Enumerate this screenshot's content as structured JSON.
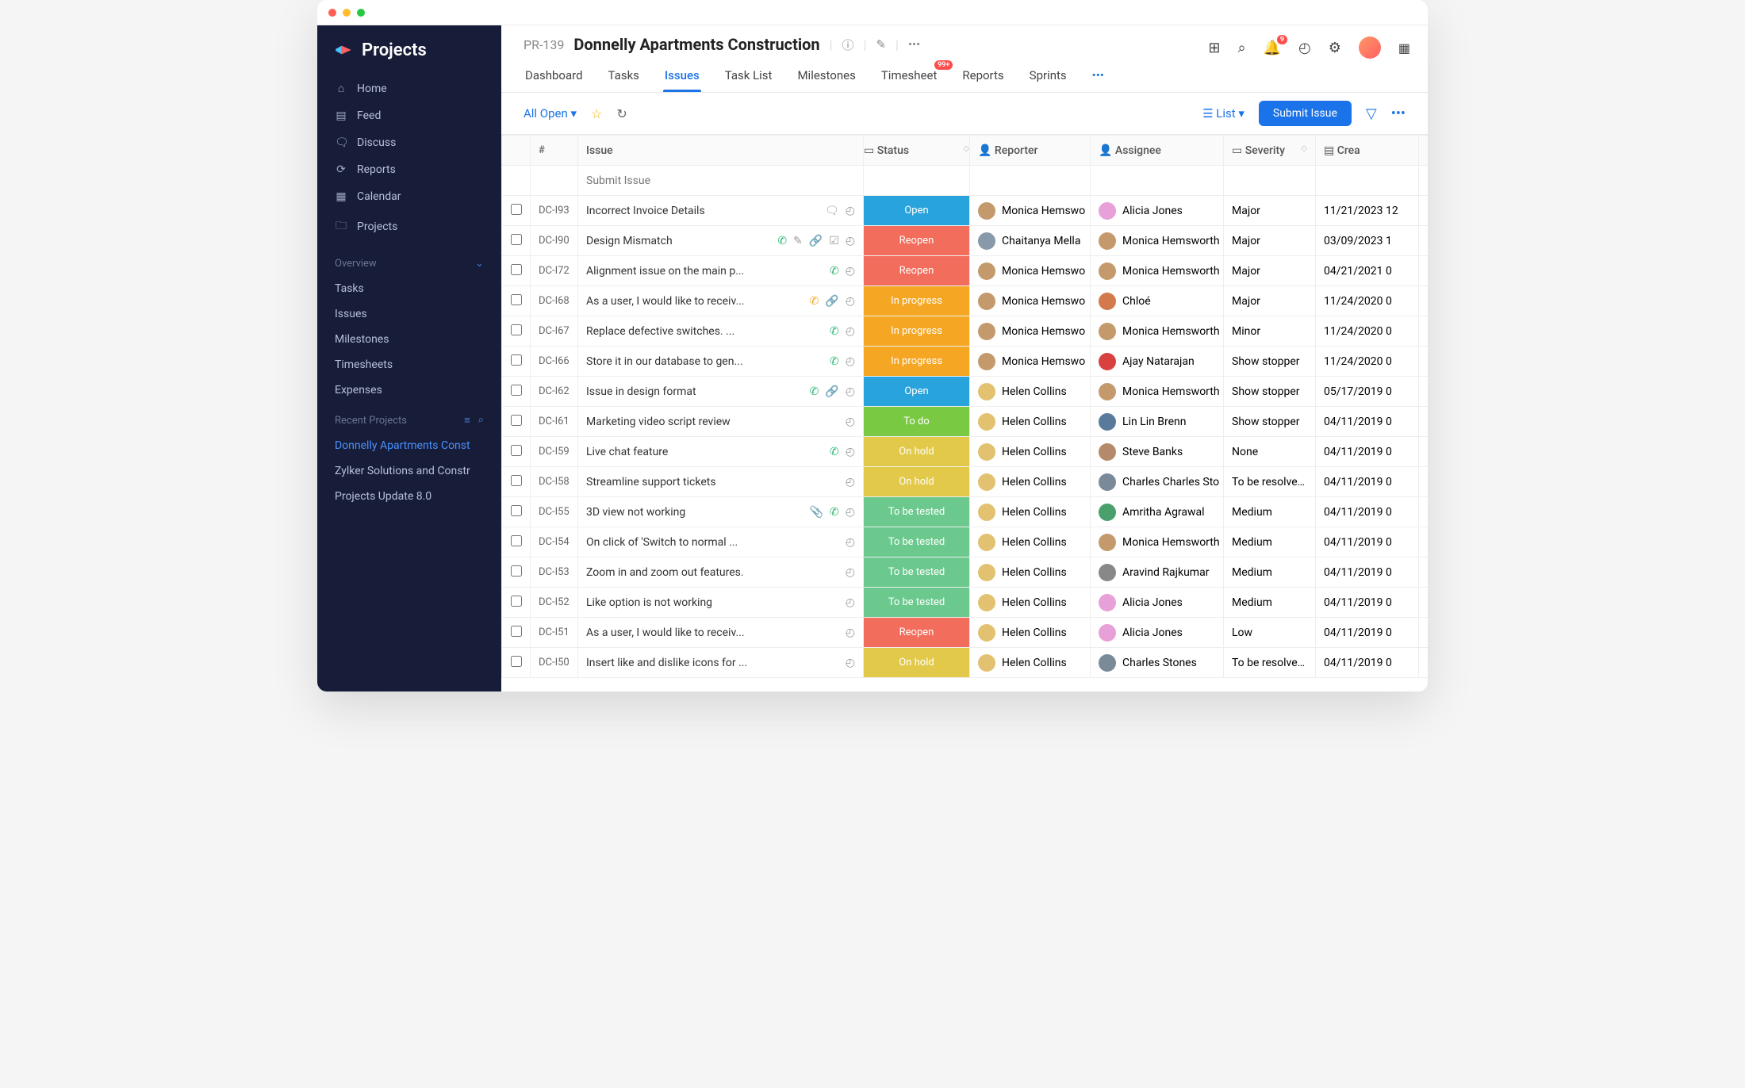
{
  "brand": "Projects",
  "nav": [
    {
      "icon": "⌂",
      "label": "Home"
    },
    {
      "icon": "▤",
      "label": "Feed"
    },
    {
      "icon": "🗨",
      "label": "Discuss"
    },
    {
      "icon": "⟳",
      "label": "Reports"
    },
    {
      "icon": "▦",
      "label": "Calendar"
    },
    {
      "icon": "🗀",
      "label": "Projects"
    }
  ],
  "overview_label": "Overview",
  "subnav": [
    "Tasks",
    "Issues",
    "Milestones",
    "Timesheets",
    "Expenses"
  ],
  "recent_label": "Recent Projects",
  "recent": [
    "Donnelly Apartments Const",
    "Zylker Solutions and Constr",
    "Projects Update 8.0"
  ],
  "header": {
    "project_key": "PR-139",
    "project_name": "Donnelly Apartments Construction",
    "notif_badge": "9",
    "timesheet_badge": "99+"
  },
  "tabs": [
    "Dashboard",
    "Tasks",
    "Issues",
    "Task List",
    "Milestones",
    "Timesheet",
    "Reports",
    "Sprints"
  ],
  "active_tab": "Issues",
  "toolbar": {
    "view_filter": "All Open",
    "list_label": "List",
    "submit_label": "Submit Issue",
    "submit_placeholder": "Submit Issue"
  },
  "columns": {
    "num": "#",
    "issue": "Issue",
    "status": "Status",
    "reporter": "Reporter",
    "assignee": "Assignee",
    "severity": "Severity",
    "created": "Crea"
  },
  "status_colors": {
    "Open": "st-open",
    "Reopen": "st-reopen",
    "In progress": "st-progress",
    "On hold": "st-hold",
    "To do": "st-todo",
    "To be tested": "st-test"
  },
  "avatar_colors": {
    "Monica Hemswo": "#c49a6c",
    "Monica Hemsworth": "#c49a6c",
    "Chaitanya Mella": "#8899aa",
    "Alicia Jones": "#e8a0d8",
    "Chloé": "#d27a4b",
    "Ajay Natarajan": "#d94040",
    "Helen Collins": "#e2c270",
    "Lin Lin Brenn": "#5a7a9c",
    "Steve Banks": "#b58a6c",
    "Charles Charles Sto": "#7a8a99",
    "Charles Stones": "#7a8a99",
    "Amritha Agrawal": "#4aa06c",
    "Aravind Rajkumar": "#888"
  },
  "issues": [
    {
      "num": "DC-I93",
      "title": "Incorrect Invoice Details",
      "icons": [
        "comment",
        "timer"
      ],
      "status": "Open",
      "reporter": "Monica Hemswo",
      "assignee": "Alicia Jones",
      "severity": "Major",
      "created": "11/21/2023 12"
    },
    {
      "num": "DC-I90",
      "title": "Design Mismatch",
      "icons": [
        "call-grn",
        "edit",
        "link",
        "check",
        "timer"
      ],
      "status": "Reopen",
      "reporter": "Chaitanya Mella",
      "assignee": "Monica Hemsworth",
      "severity": "Major",
      "created": "03/09/2023 1"
    },
    {
      "num": "DC-I72",
      "title": "Alignment issue on the main p...",
      "icons": [
        "call-grn",
        "timer"
      ],
      "status": "Reopen",
      "reporter": "Monica Hemswo",
      "assignee": "Monica Hemsworth",
      "severity": "Major",
      "created": "04/21/2021 0"
    },
    {
      "num": "DC-I68",
      "title": "As a user, I would like to receiv...",
      "icons": [
        "call-org",
        "link",
        "timer"
      ],
      "status": "In progress",
      "reporter": "Monica Hemswo",
      "assignee": "Chloé",
      "severity": "Major",
      "created": "11/24/2020 0"
    },
    {
      "num": "DC-I67",
      "title": "Replace defective switches. ...",
      "icons": [
        "call-grn",
        "timer"
      ],
      "status": "In progress",
      "reporter": "Monica Hemswo",
      "assignee": "Monica Hemsworth",
      "severity": "Minor",
      "created": "11/24/2020 0"
    },
    {
      "num": "DC-I66",
      "title": "Store it in our database to gen...",
      "icons": [
        "call-grn",
        "timer"
      ],
      "status": "In progress",
      "reporter": "Monica Hemswo",
      "assignee": "Ajay Natarajan",
      "severity": "Show stopper",
      "created": "11/24/2020 0"
    },
    {
      "num": "DC-I62",
      "title": "Issue in design format",
      "icons": [
        "call-grn",
        "link",
        "timer"
      ],
      "status": "Open",
      "reporter": "Helen Collins",
      "assignee": "Monica Hemsworth",
      "severity": "Show stopper",
      "created": "05/17/2019 0"
    },
    {
      "num": "DC-I61",
      "title": "Marketing video script review",
      "icons": [
        "timer"
      ],
      "status": "To do",
      "reporter": "Helen Collins",
      "assignee": "Lin Lin Brenn",
      "severity": "Show stopper",
      "created": "04/11/2019 0"
    },
    {
      "num": "DC-I59",
      "title": "Live chat feature",
      "icons": [
        "call-grn",
        "timer"
      ],
      "status": "On hold",
      "reporter": "Helen Collins",
      "assignee": "Steve Banks",
      "severity": "None",
      "created": "04/11/2019 0"
    },
    {
      "num": "DC-I58",
      "title": "Streamline support tickets",
      "icons": [
        "timer"
      ],
      "status": "On hold",
      "reporter": "Helen Collins",
      "assignee": "Charles Charles Sto",
      "severity": "To be resolved la",
      "created": "04/11/2019 0"
    },
    {
      "num": "DC-I55",
      "title": "3D view not working",
      "icons": [
        "attach",
        "call-grn",
        "timer"
      ],
      "status": "To be tested",
      "reporter": "Helen Collins",
      "assignee": "Amritha Agrawal",
      "severity": "Medium",
      "created": "04/11/2019 0"
    },
    {
      "num": "DC-I54",
      "title": "On click of 'Switch to normal ...",
      "icons": [
        "timer"
      ],
      "status": "To be tested",
      "reporter": "Helen Collins",
      "assignee": "Monica Hemsworth",
      "severity": "Medium",
      "created": "04/11/2019 0"
    },
    {
      "num": "DC-I53",
      "title": "Zoom in and zoom out features.",
      "icons": [
        "timer"
      ],
      "status": "To be tested",
      "reporter": "Helen Collins",
      "assignee": "Aravind Rajkumar",
      "severity": "Medium",
      "created": "04/11/2019 0"
    },
    {
      "num": "DC-I52",
      "title": "Like option is not working",
      "icons": [
        "timer"
      ],
      "status": "To be tested",
      "reporter": "Helen Collins",
      "assignee": "Alicia Jones",
      "severity": "Medium",
      "created": "04/11/2019 0"
    },
    {
      "num": "DC-I51",
      "title": "As a user, I would like to receiv...",
      "icons": [
        "timer"
      ],
      "status": "Reopen",
      "reporter": "Helen Collins",
      "assignee": "Alicia Jones",
      "severity": "Low",
      "created": "04/11/2019 0"
    },
    {
      "num": "DC-I50",
      "title": "Insert like and dislike icons for ...",
      "icons": [
        "timer"
      ],
      "status": "On hold",
      "reporter": "Helen Collins",
      "assignee": "Charles Stones",
      "severity": "To be resolved la",
      "created": "04/11/2019 0"
    }
  ]
}
